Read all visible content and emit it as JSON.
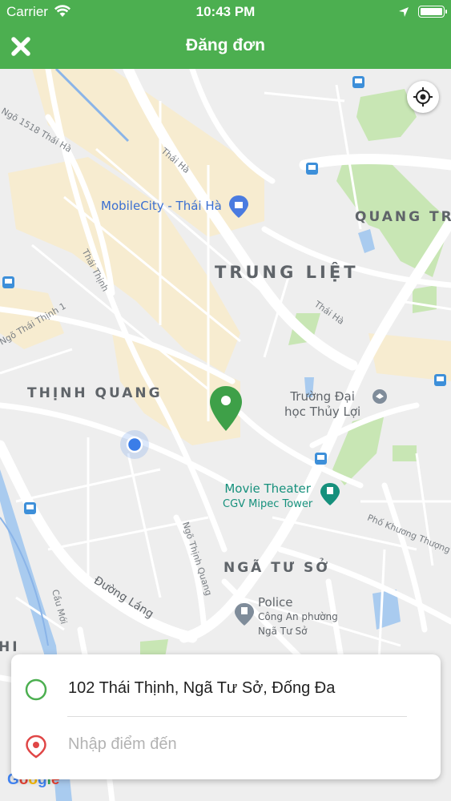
{
  "status_bar": {
    "carrier": "Carrier",
    "time": "10:43 PM"
  },
  "header": {
    "title": "Đăng đơn"
  },
  "map": {
    "districts": [
      "TRUNG LIỆT",
      "THỊNH QUANG",
      "NGÃ TƯ SỞ",
      "QUANG TR",
      "HI"
    ],
    "streets": [
      "Thái Hà",
      "Thái Hà",
      "Thái Thịnh",
      "Ngõ 1518 Thái Hà",
      "Ngõ Thái Thịnh 1",
      "Đường Láng",
      "Cầu Mới",
      "Ngõ Thịnh Quang",
      "Phố Khương Thượng"
    ],
    "pois": {
      "mobilecity": "MobileCity - Thái Hà",
      "university_line1": "Trường Đại",
      "university_line2": "học Thủy Lợi",
      "theater_line1": "Movie Theater",
      "theater_line2": "CGV Mipec Tower",
      "police_line1": "Police",
      "police_line2": "Công An phường",
      "police_line3": "Ngã Tư Sở"
    },
    "attribution": "Google"
  },
  "colors": {
    "brand_green": "#4caf50",
    "pin_green": "#3ea048",
    "user_dot": "#3b7de8",
    "dest_red": "#e04646"
  },
  "pickup": {
    "value": "102 Thái Thịnh, Ngã Tư Sở, Đống Đa",
    "icon": "green-circle-icon"
  },
  "destination": {
    "placeholder": "Nhập điểm đến",
    "icon": "red-location-pin-icon"
  }
}
